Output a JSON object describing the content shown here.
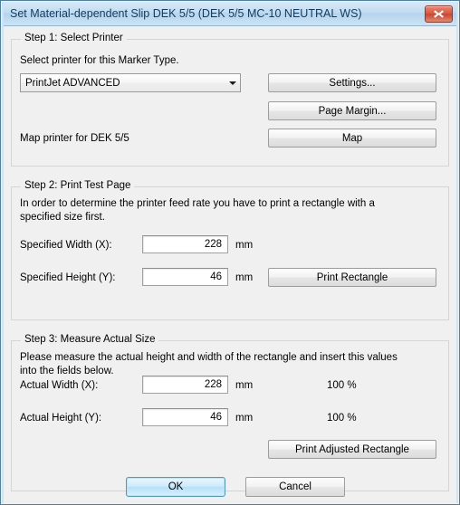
{
  "window": {
    "title": "Set Material-dependent Slip DEK 5/5 (DEK 5/5 MC-10 NEUTRAL WS)",
    "close_icon": "close-x-icon"
  },
  "step1": {
    "legend": "Step 1: Select Printer",
    "instruction": "Select printer for this Marker Type.",
    "printer_combo": {
      "value": "PrintJet ADVANCED",
      "arrow_icon": "chevron-down-icon"
    },
    "settings_button": "Settings...",
    "page_margin_button": "Page Margin...",
    "map_label": "Map printer for DEK 5/5",
    "map_button": "Map"
  },
  "step2": {
    "legend": "Step 2: Print Test Page",
    "instruction": "In order to determine the printer feed rate you have to print a rectangle with a specified size first.",
    "width_label": "Specified Width (X):",
    "width_value": "228",
    "width_unit": "mm",
    "height_label": "Specified Height (Y):",
    "height_value": "46",
    "height_unit": "mm",
    "print_rectangle_button": "Print Rectangle"
  },
  "step3": {
    "legend": "Step 3: Measure Actual Size",
    "instruction": "Please measure the actual height and width of the rectangle and insert this values into the fields below.",
    "width_label": "Actual Width (X):",
    "width_value": "228",
    "width_unit": "mm",
    "width_percent": "100 %",
    "height_label": "Actual Height (Y):",
    "height_value": "46",
    "height_unit": "mm",
    "height_percent": "100 %",
    "print_adjusted_button": "Print Adjusted Rectangle"
  },
  "footer": {
    "ok_button": "OK",
    "cancel_button": "Cancel"
  },
  "colors": {
    "title_bar": "#c3dcf0",
    "window_border": "#4b7fa8",
    "close_button": "#c94631",
    "dialog_background": "#f0f0f0",
    "default_button_accent": "#4f9ac4"
  }
}
